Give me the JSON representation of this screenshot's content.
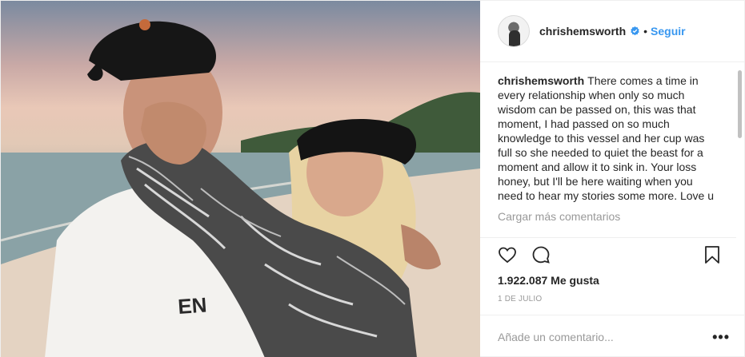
{
  "post": {
    "username": "chrishemsworth",
    "verified_icon": "verified-badge-icon",
    "separator": "•",
    "follow_label": "Seguir",
    "caption_user": "chrishemsworth",
    "caption_text": "There comes a time in every relationship when only so much wisdom can be passed on, this was that moment, I had passed on so much knowledge to this vessel and her cup was full so she needed to quiet the beast for a moment and allow it to sink in. Your loss honey, but I'll be here waiting when you need to hear my stories some more. Love u",
    "load_more_label": "Cargar más comentarios",
    "likes": "1.922.087 Me gusta",
    "date": "1 DE JULIO",
    "comment_placeholder": "Añade un comentario...",
    "more_label": "•••"
  },
  "colors": {
    "accent": "#3897f0",
    "muted": "#999999",
    "text": "#262626",
    "border": "#efefef"
  },
  "icons": [
    "heart-icon",
    "comment-icon",
    "bookmark-icon",
    "verified-badge-icon"
  ]
}
